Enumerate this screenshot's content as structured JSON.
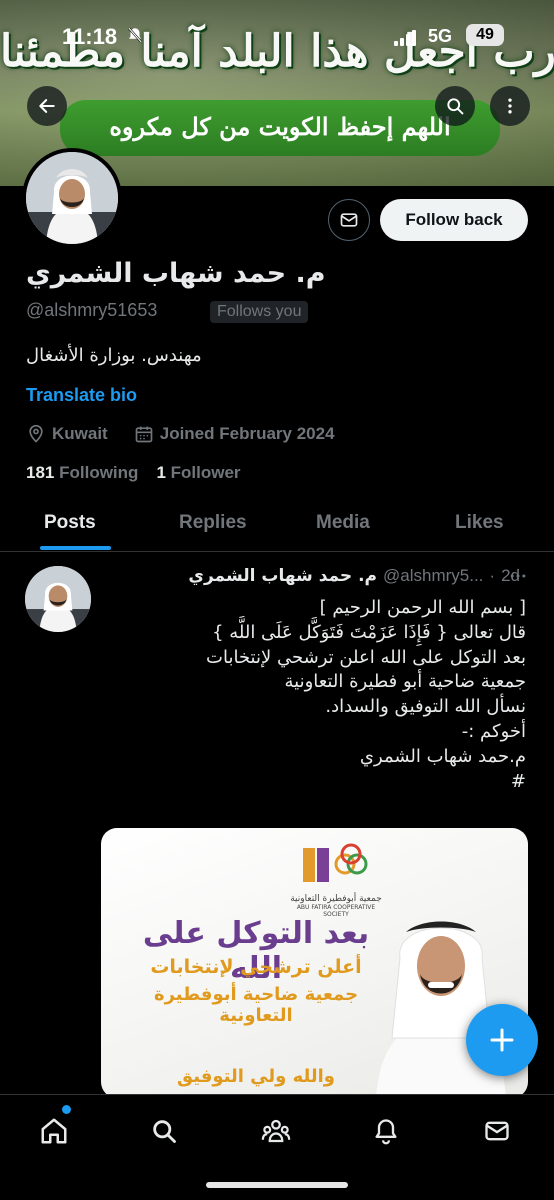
{
  "status_bar": {
    "time": "11:18",
    "network": "5G",
    "battery": "49"
  },
  "banner": {
    "text_top": "رب اجعل هذا البلد آمنا مطمئنا",
    "text_bottom": "اللهم إحفظ الكويت من كل مكروه"
  },
  "profile": {
    "name": "م. حمد شهاب الشمري",
    "handle": "@alshmry51653",
    "follows_you": "Follows you",
    "follow_back_label": "Follow back",
    "bio": "مهندس. بوزارة الأشغال",
    "translate_bio": "Translate bio",
    "location": "Kuwait",
    "joined": "Joined February 2024",
    "following_count": "181",
    "following_label": "Following",
    "followers_count": "1",
    "followers_label": "Follower"
  },
  "tabs": [
    {
      "label": "Posts",
      "active": true
    },
    {
      "label": "Replies",
      "active": false
    },
    {
      "label": "Media",
      "active": false
    },
    {
      "label": "Likes",
      "active": false
    }
  ],
  "post": {
    "name": "م. حمد شهاب الشمري",
    "handle": "@alshmry5...",
    "time": "2d",
    "lines": [
      "[ بسم الله الرحمن الرحيم ]",
      "قال تعالى { فَإِذَا عَزَمْتَ فَتَوَكَّل عَلَى اللَّه }",
      "بعد التوكل على الله اعلن ترشحي لإنتخابات",
      "جمعية ضاحية أبو فطيرة التعاونية",
      "نسأل الله التوفيق والسداد.",
      "أخوكم :-",
      "م.حمد شهاب الشمري",
      "#"
    ],
    "media": {
      "logo_text": "جمعية أبوفطيرة التعاونية",
      "logo_text_en": "ABU FATIRA COOPERATIVE SOCIETY",
      "headline": "بعد التوكل على الله",
      "sub1": "أعلن ترشحي لإنتخابات",
      "sub2": "جمعية ضاحية أبوفطيرة التعاونية",
      "sub3": "والله ولي التوفيق"
    }
  },
  "colors": {
    "accent": "#1d9bf0",
    "background": "#000000",
    "muted": "#71767b",
    "text": "#e7e9ea"
  },
  "icons": {
    "back": "arrow-left-icon",
    "search": "search-icon",
    "more": "more-vertical-icon",
    "message": "envelope-icon",
    "location": "location-pin-icon",
    "calendar": "calendar-icon",
    "compose": "plus-icon",
    "nav": [
      "home-icon",
      "search-icon",
      "communities-icon",
      "bell-icon",
      "envelope-icon"
    ]
  }
}
